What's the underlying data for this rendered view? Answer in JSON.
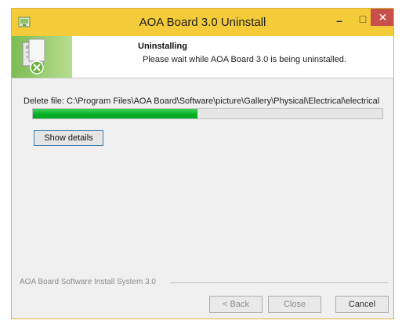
{
  "window": {
    "title": "AOA Board 3.0 Uninstall",
    "minimize_glyph": "–",
    "maximize_glyph": "□",
    "close_glyph": "✕"
  },
  "header": {
    "title": "Uninstalling",
    "subtitle": "Please wait while AOA Board 3.0 is being uninstalled."
  },
  "status": {
    "text": "Delete file: C:\\Program Files\\AOA Board\\Software\\picture\\Gallery\\Physical\\Electrical\\electrical"
  },
  "progress": {
    "fraction": 0.47
  },
  "details_button": {
    "label": "Show details"
  },
  "footer": {
    "brand": "AOA Board Software Install System 3.0"
  },
  "buttons": {
    "back": "< Back",
    "close": "Close",
    "cancel": "Cancel"
  },
  "colors": {
    "titlebar": "#f4cc3a",
    "progress": "#06b025",
    "close_button": "#c7504b"
  },
  "icons": {
    "app": "installer-icon",
    "header": "uninstall-icon"
  }
}
